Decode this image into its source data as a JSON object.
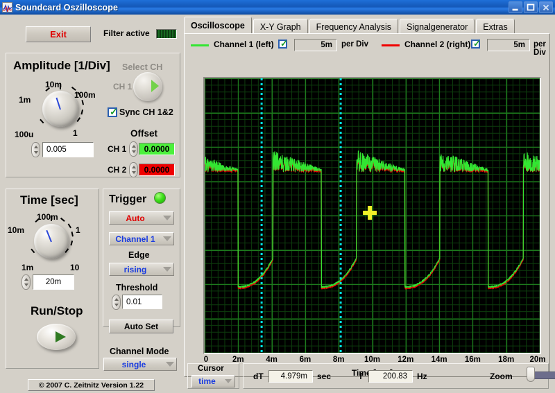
{
  "window": {
    "title": "Soundcard Oszilloscope",
    "icon": "waveform-icon",
    "minimize_label": "minimize-icon",
    "maximize_label": "maximize-icon",
    "close_label": "close-icon"
  },
  "toolbar": {
    "exit_label": "Exit",
    "filter_label": "Filter active",
    "filter_led_state": "on"
  },
  "amplitude": {
    "title": "Amplitude [1/Div]",
    "knob_labels": [
      "100u",
      "1m",
      "10m",
      "100m",
      "1"
    ],
    "value": "0.005",
    "select_ch_title": "Select CH",
    "select_ch_value": "CH 1",
    "sync_label": "Sync CH 1&2",
    "sync_checked": true,
    "offset_title": "Offset",
    "offsets": [
      {
        "label": "CH 1",
        "value": "0.0000",
        "color": "#4cf03c"
      },
      {
        "label": "CH 2",
        "value": "0.0000",
        "color": "#f00000"
      }
    ]
  },
  "time": {
    "title": "Time [sec]",
    "knob_labels": [
      "1m",
      "10m",
      "100m",
      "1",
      "10"
    ],
    "value": "20m",
    "runstop_label": "Run/Stop"
  },
  "trigger": {
    "title": "Trigger",
    "led_state": "on",
    "mode": "Auto",
    "mode_color": "#e00000",
    "source": "Channel 1",
    "source_color": "#1a3ce0",
    "edge_label": "Edge",
    "edge": "rising",
    "edge_color": "#1a3ce0",
    "threshold_label": "Threshold",
    "threshold": "0.01",
    "autoset_label": "Auto Set"
  },
  "channel_mode": {
    "label": "Channel Mode",
    "value": "single",
    "value_color": "#1a3ce0"
  },
  "footer": {
    "copyright": "© 2007   C. Zeitnitz Version 1.22"
  },
  "tabs": [
    {
      "label": "Oscilloscope",
      "active": true
    },
    {
      "label": "X-Y Graph",
      "active": false
    },
    {
      "label": "Frequency Analysis",
      "active": false
    },
    {
      "label": "Signalgenerator",
      "active": false
    },
    {
      "label": "Extras",
      "active": false
    }
  ],
  "channels": [
    {
      "name": "Channel 1 (left)",
      "color": "#32e632",
      "enabled": true,
      "per_div_value": "5m",
      "per_div_label": "per Div"
    },
    {
      "name": "Channel 2 (right)",
      "color": "#f00000",
      "enabled": true,
      "per_div_value": "5m",
      "per_div_label": "per Div"
    }
  ],
  "cursor": {
    "title": "Cursor",
    "mode": "time",
    "mode_color": "#1a3ce0",
    "dt_label": "dT",
    "dt_value": "4.979m",
    "dt_unit": "sec",
    "f_label": "f",
    "f_value": "200.83",
    "f_unit": "Hz",
    "zoom_label": "Zoom",
    "zoom_value": 0
  },
  "chart_data": {
    "type": "line",
    "title": "",
    "xlabel": "Time [sec]",
    "ylabel": "",
    "xlim": [
      0,
      0.02
    ],
    "grid": true,
    "grid_color": "#1d7a1d",
    "background": "#000000",
    "xticks": [
      0,
      0.002,
      0.004,
      0.006,
      0.008,
      0.01,
      0.012,
      0.014,
      0.016,
      0.018,
      0.02
    ],
    "xtick_labels": [
      "0",
      "2m",
      "4m",
      "6m",
      "8m",
      "10m",
      "12m",
      "14m",
      "16m",
      "18m",
      "20m"
    ],
    "divisions_x": 10,
    "divisions_y": 8,
    "volts_per_div": 0.005,
    "sec_per_div": 0.002,
    "legend_position": "top",
    "series": [
      {
        "name": "Channel 1 (left)",
        "color": "#32e632",
        "waveform": "pulse-train-decaying"
      },
      {
        "name": "Channel 2 (right)",
        "color": "#f00000",
        "waveform": "pulse-train-decaying"
      }
    ],
    "waveform_params": {
      "period_sec": 0.00498,
      "pulse_count": 4,
      "high_level_start": 0.385,
      "high_level_end": 0.33,
      "low_level_start": -0.52,
      "low_level_end": -0.31,
      "noise_amplitude": 0.075
    },
    "cursors": [
      {
        "name": "cursor-1",
        "x": 0.0034,
        "color": "#00e5e5",
        "style": "dotted-vertical"
      },
      {
        "name": "cursor-2",
        "x": 0.00812,
        "color": "#00e5e5",
        "style": "dotted-vertical"
      }
    ],
    "markers": [
      {
        "name": "cursor-crosshair",
        "x": 0.00986,
        "y": 0.02,
        "color": "#f0f028"
      }
    ]
  }
}
